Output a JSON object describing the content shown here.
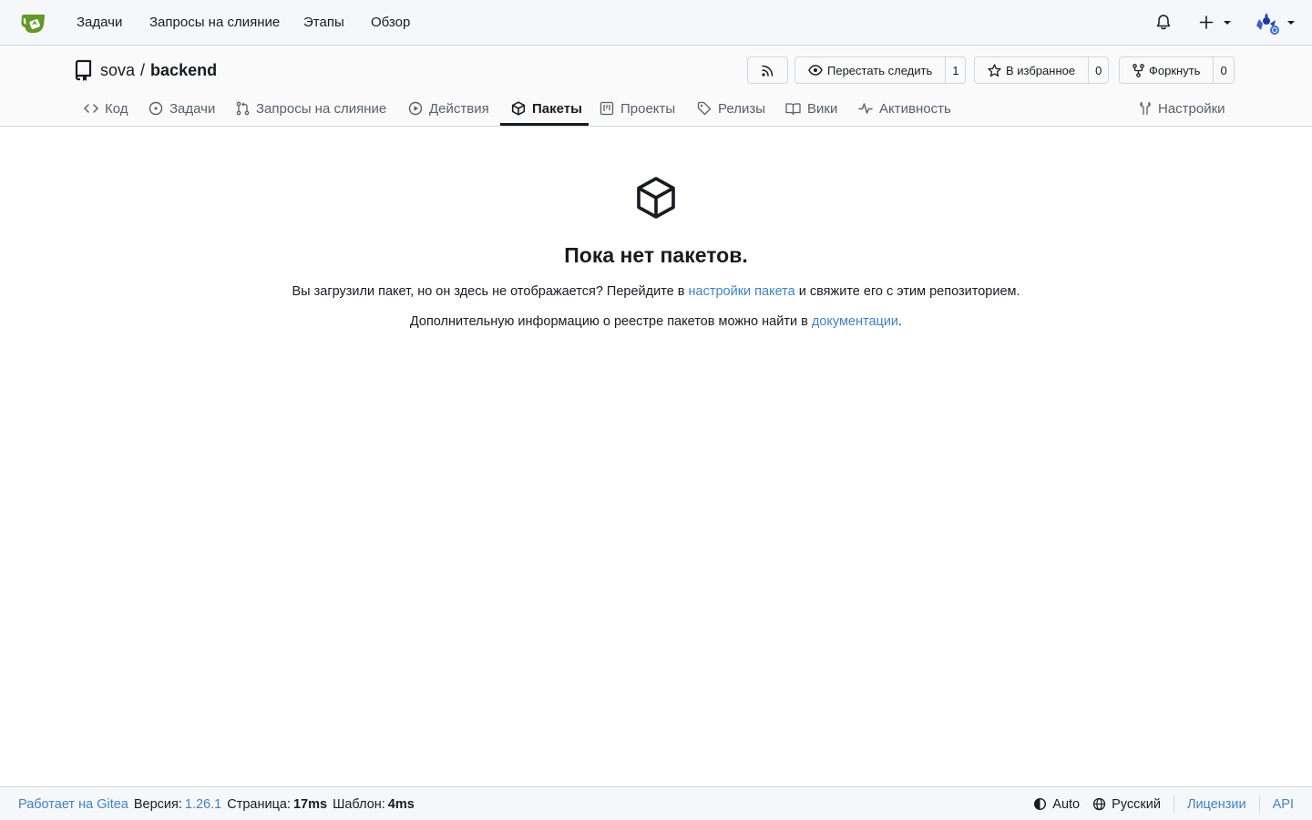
{
  "nav": {
    "items": [
      "Задачи",
      "Запросы на слияние",
      "Этапы",
      "Обзор"
    ],
    "icons": [
      "gitea-logo-icon",
      "bell-icon",
      "plus-icon",
      "avatar"
    ]
  },
  "repo": {
    "owner": "sova",
    "separator": "/",
    "name": "backend",
    "unwatch_label": "Перестать следить",
    "unwatch_count": "1",
    "star_label": "В избранное",
    "star_count": "0",
    "fork_label": "Форкнуть",
    "fork_count": "0"
  },
  "tabs": {
    "code": "Код",
    "issues": "Задачи",
    "pulls": "Запросы на слияние",
    "actions": "Действия",
    "packages": "Пакеты",
    "projects": "Проекты",
    "releases": "Релизы",
    "wiki": "Вики",
    "activity": "Активность",
    "settings": "Настройки",
    "active": "packages"
  },
  "empty": {
    "title": "Пока нет пакетов.",
    "line1_before": "Вы загрузили пакет, но он здесь не отображается? Перейдите в ",
    "line1_link": "настройки пакета",
    "line1_after": " и свяжите его с этим репозиторием.",
    "line2_before": "Дополнительную информацию о реестре пакетов можно найти в ",
    "line2_link": "документации",
    "line2_after": "."
  },
  "footer": {
    "powered": "Работает на Gitea",
    "version_label": "Версия:",
    "version": "1.26.1",
    "page_label": "Страница:",
    "page_time": "17ms",
    "template_label": "Шаблон:",
    "template_time": "4ms",
    "theme": "Auto",
    "language": "Русский",
    "licenses": "Лицензии",
    "api": "API"
  },
  "colors": {
    "accent": "#4183c4",
    "text": "#181c21",
    "gitea_green": "#609926"
  }
}
